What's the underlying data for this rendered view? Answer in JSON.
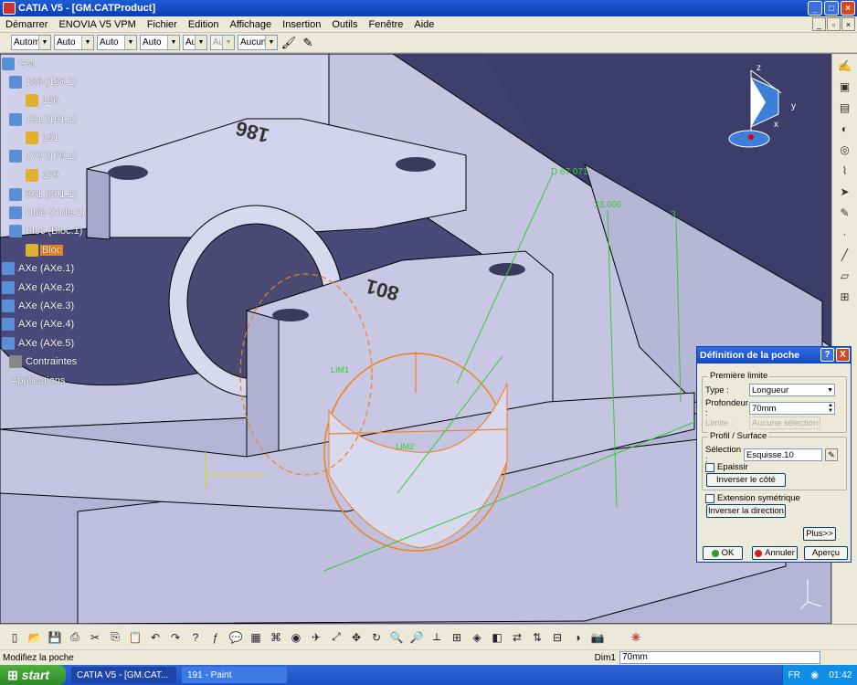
{
  "window": {
    "title": "CATIA V5 - [GM.CATProduct]"
  },
  "menu": [
    "Démarrer",
    "ENOVIA V5 VPM",
    "Fichier",
    "Edition",
    "Affichage",
    "Insertion",
    "Outils",
    "Fenêtre",
    "Aide"
  ],
  "toolbar": {
    "combos": [
      {
        "value": "Automa",
        "disabled": false
      },
      {
        "value": "Auto",
        "disabled": false
      },
      {
        "value": "Auto",
        "disabled": false
      },
      {
        "value": "Auto",
        "disabled": false
      },
      {
        "value": "Aut",
        "disabled": false
      },
      {
        "value": "Aut",
        "disabled": true
      },
      {
        "value": "Aucun",
        "disabled": false
      }
    ]
  },
  "tree": {
    "items": [
      {
        "label": "GM",
        "type": "product",
        "selected": false
      },
      {
        "label": "186 (186.1)",
        "type": "product",
        "selected": false
      },
      {
        "label": "186",
        "type": "part",
        "selected": false
      },
      {
        "label": "191 (191.1)",
        "type": "product",
        "selected": false
      },
      {
        "label": "191",
        "type": "part",
        "selected": false
      },
      {
        "label": "179 (179.1)",
        "type": "product",
        "selected": false
      },
      {
        "label": "179",
        "type": "part",
        "selected": false
      },
      {
        "label": "801 (801.1)",
        "type": "product",
        "selected": false
      },
      {
        "label": "Hule (Hule.1)",
        "type": "product",
        "selected": false
      },
      {
        "label": "Bloc (Bloc.1)",
        "type": "product",
        "selected": false
      },
      {
        "label": "Bloc",
        "type": "part",
        "selected": true
      },
      {
        "label": "AXe (AXe.1)",
        "type": "product",
        "selected": false
      },
      {
        "label": "AXe (AXe.2)",
        "type": "product",
        "selected": false
      },
      {
        "label": "AXe (AXe.3)",
        "type": "product",
        "selected": false
      },
      {
        "label": "AXe (AXe.4)",
        "type": "product",
        "selected": false
      },
      {
        "label": "AXe (AXe.5)",
        "type": "product",
        "selected": false
      },
      {
        "label": "Contraintes",
        "type": "constraints",
        "selected": false
      },
      {
        "label": "Applications",
        "type": "apps",
        "selected": false
      }
    ]
  },
  "viewport": {
    "dimensions": [
      {
        "text": "D 67.071"
      },
      {
        "text": "33.606"
      },
      {
        "text": "3"
      }
    ],
    "labels": {
      "lim1": "LIM1",
      "lim2": "LIM2",
      "engrave1": "186",
      "engrave2": "801"
    },
    "compass": {
      "x": "x",
      "y": "y",
      "z": "z"
    }
  },
  "dialog": {
    "title": "Définition de la poche",
    "help": "?",
    "close": "X",
    "first_limit": {
      "legend": "Première limite",
      "type_label": "Type :",
      "type_value": "Longueur",
      "depth_label": "Profondeur :",
      "depth_value": "70mm",
      "limit_label": "Limite :",
      "limit_value": "Aucune sélection"
    },
    "profile": {
      "legend": "Profil / Surface",
      "selection_label": "Sélection :",
      "selection_value": "Esquisse.10",
      "thick_label": "Epaissir",
      "invert_side": "Inverser le côté"
    },
    "sym_label": "Extension symétrique",
    "invert_dir": "Inverser la direction",
    "more": "Plus>>",
    "ok": "OK",
    "cancel": "Annuler",
    "preview": "Aperçu"
  },
  "status": {
    "message": "Modifiez la poche",
    "dim_label": "Dim1",
    "dim_value": "70mm"
  },
  "taskbar": {
    "start": "start",
    "tasks": [
      "CATIA V5 - [GM.CAT...",
      "191 - Paint"
    ],
    "lang": "FR",
    "time": "01:42"
  },
  "colors": {
    "viewport_bg": "#3f3f6c",
    "part": "#c8c8e4",
    "sketch": "#f08018",
    "dims": "#33cc33",
    "selection": "#f08018"
  }
}
